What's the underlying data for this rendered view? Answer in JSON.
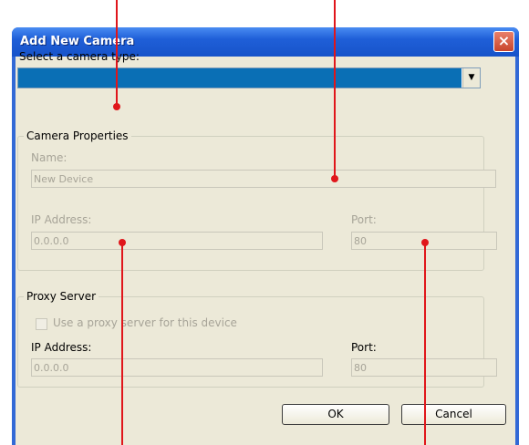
{
  "window": {
    "title": "Add New Camera",
    "close_icon": "×"
  },
  "camera_type": {
    "label": "Select a camera type:",
    "value": "",
    "arrow": "▼"
  },
  "camera_properties": {
    "legend": "Camera Properties",
    "name_label": "Name:",
    "name_value": "New Device",
    "ip_label": "IP Address:",
    "ip_value": "0.0.0.0",
    "port_label": "Port:",
    "port_value": "80"
  },
  "proxy_server": {
    "legend": "Proxy Server",
    "use_proxy_label": "Use a proxy server for this device",
    "ip_label": "IP Address:",
    "ip_value": "0.0.0.0",
    "port_label": "Port:",
    "port_value": "80"
  },
  "buttons": {
    "ok": "OK",
    "cancel": "Cancel"
  },
  "colors": {
    "title_bar": "#1f5fd8",
    "selection": "#0a6fb5",
    "annotation": "#e0161b"
  }
}
